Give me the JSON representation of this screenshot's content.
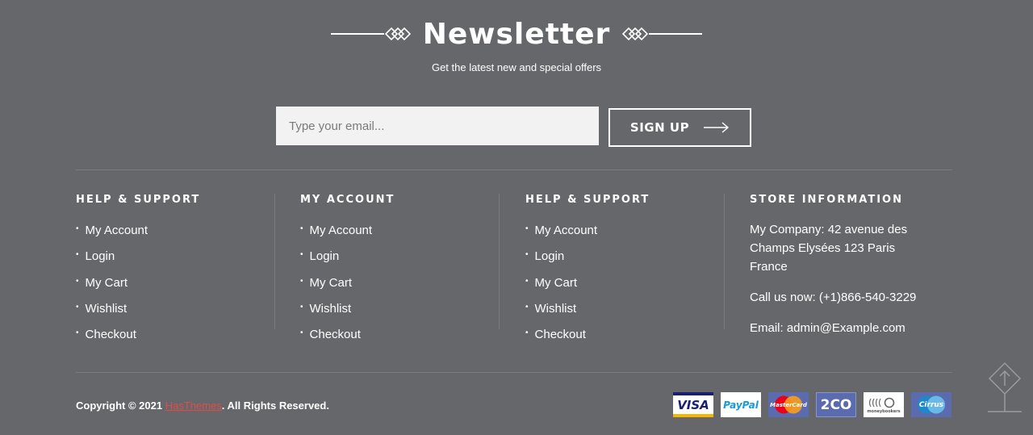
{
  "newsletter": {
    "title": "Newsletter",
    "subtitle": "Get the latest new and special offers",
    "email_placeholder": "Type your email...",
    "signup_label": "SIGN UP"
  },
  "columns": [
    {
      "title": "HELP & SUPPORT",
      "links": [
        "My Account",
        "Login",
        "My Cart",
        "Wishlist",
        "Checkout"
      ]
    },
    {
      "title": "MY ACCOUNT",
      "links": [
        "My Account",
        "Login",
        "My Cart",
        "Wishlist",
        "Checkout"
      ]
    },
    {
      "title": "HELP & SUPPORT",
      "links": [
        "My Account",
        "Login",
        "My Cart",
        "Wishlist",
        "Checkout"
      ]
    }
  ],
  "store": {
    "title": "STORE INFORMATION",
    "address": "My Company: 42 avenue des Champs Elysées 123 Paris France",
    "phone": "Call us now: (+1)866-540-3229",
    "email": "Email: admin@Example.com"
  },
  "footer": {
    "copyright_prefix": "Copyright © 2021 ",
    "brand": "HasThemes",
    "copyright_suffix": ". All Rights Reserved."
  },
  "payments": [
    {
      "name": "VISA",
      "icon": "visa-icon"
    },
    {
      "name": "PayPal",
      "icon": "paypal-icon"
    },
    {
      "name": "MasterCard",
      "icon": "mastercard-icon"
    },
    {
      "name": "2CO",
      "icon": "2co-icon"
    },
    {
      "name": "moneybookers",
      "icon": "moneybookers-icon"
    },
    {
      "name": "Cirrus",
      "icon": "cirrus-icon"
    }
  ],
  "colors": {
    "background": "#66676b",
    "accent_link": "#e14b4b",
    "input_bg": "#f2f2f2"
  }
}
